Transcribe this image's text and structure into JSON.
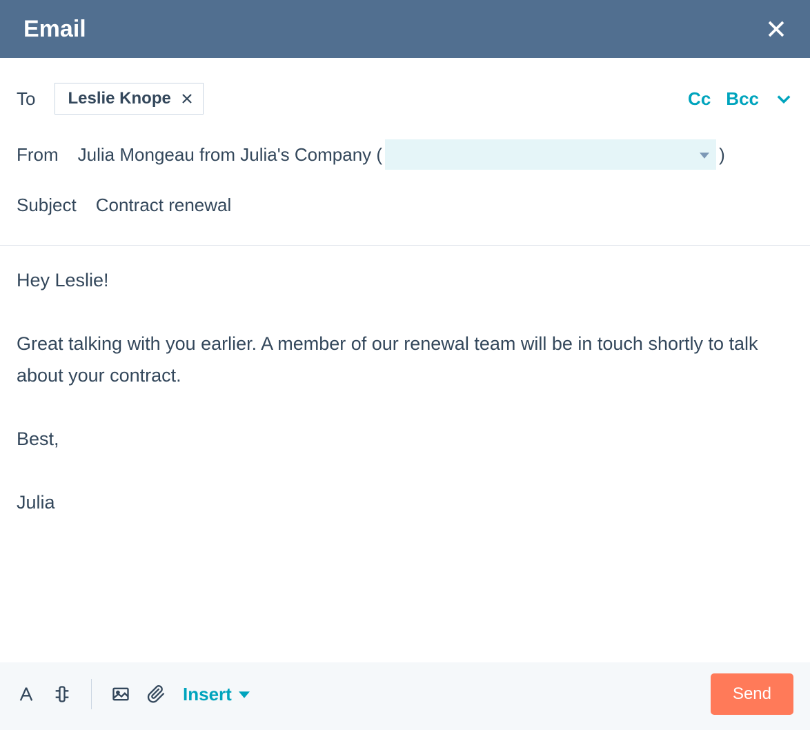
{
  "header": {
    "title": "Email"
  },
  "to": {
    "label": "To",
    "recipient": "Leslie Knope",
    "cc_label": "Cc",
    "bcc_label": "Bcc"
  },
  "from": {
    "label": "From",
    "name_part": "Julia Mongeau from Julia's Company  (",
    "closing": ")"
  },
  "subject": {
    "label": "Subject",
    "value": "Contract renewal"
  },
  "body": {
    "greeting": "Hey Leslie!",
    "paragraph": "Great talking with you earlier. A member of our renewal team will be in touch shortly to talk about your contract.",
    "signoff": "Best,",
    "signature": "Julia"
  },
  "footer": {
    "insert_label": "Insert",
    "send_label": "Send"
  }
}
